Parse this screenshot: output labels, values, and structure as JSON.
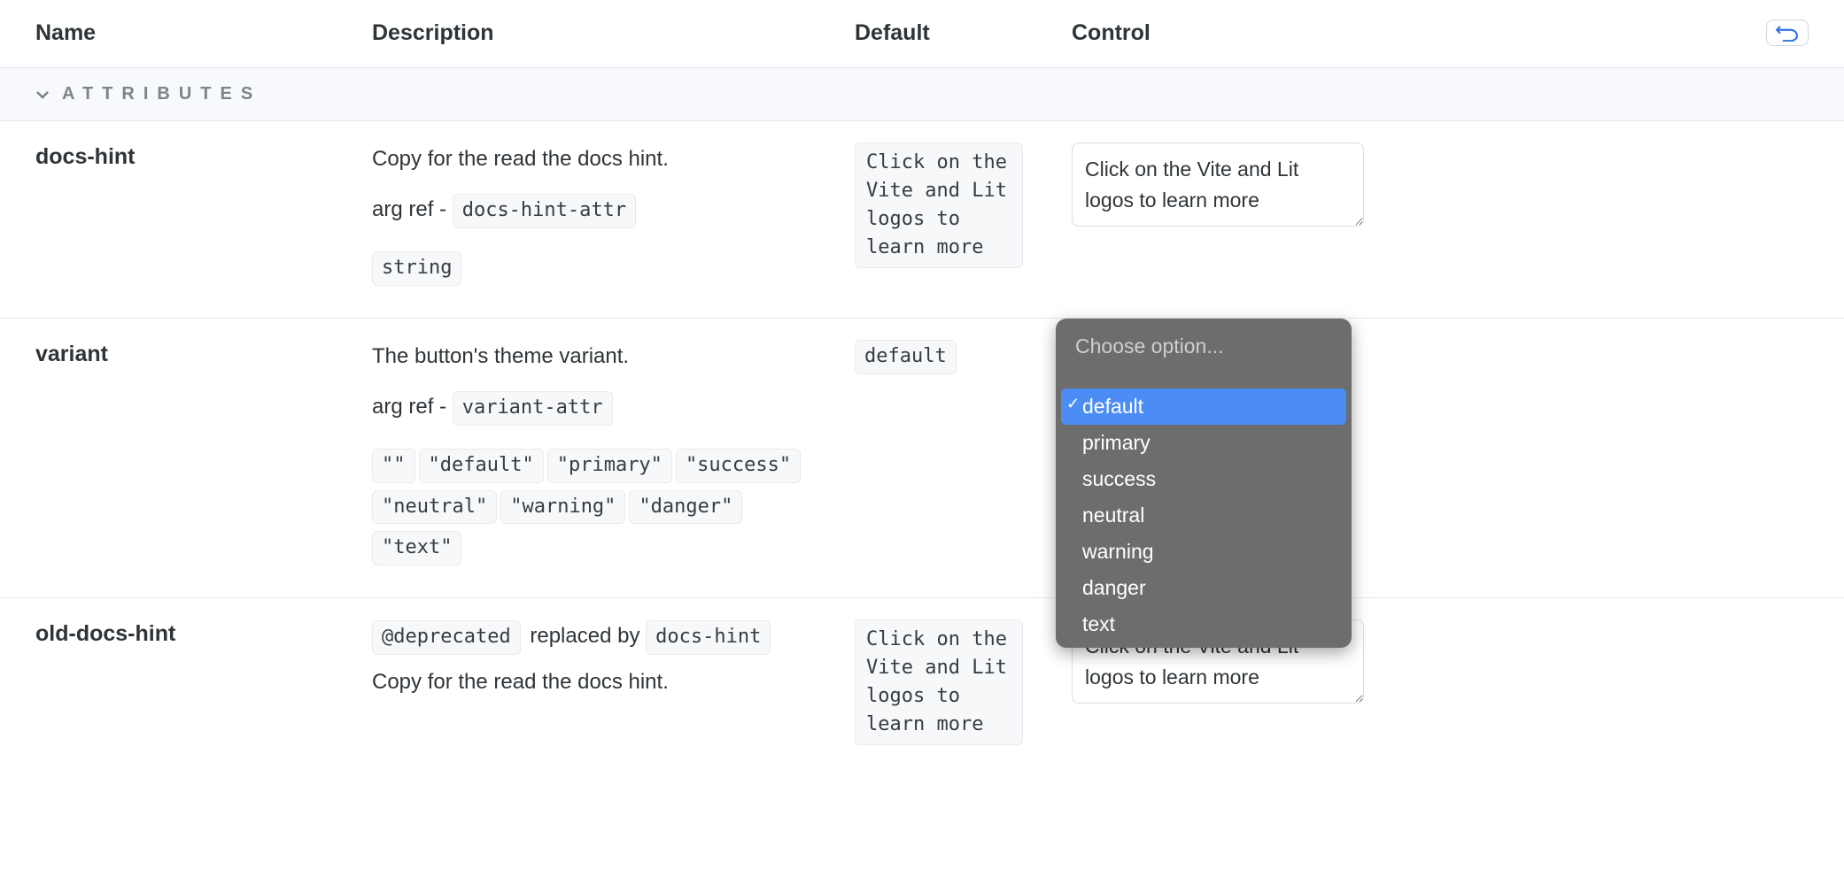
{
  "columns": {
    "name": "Name",
    "description": "Description",
    "default": "Default",
    "control": "Control"
  },
  "section": {
    "title": "ATTRIBUTES"
  },
  "rows": {
    "docsHint": {
      "name": "docs-hint",
      "description": "Copy for the read the docs hint.",
      "argRefPrefix": "arg ref - ",
      "argRef": "docs-hint-attr",
      "type": "string",
      "default": "Click on the Vite and Lit logos to learn more",
      "value": "Click on the Vite and Lit logos to learn more"
    },
    "variant": {
      "name": "variant",
      "description": "The button's theme variant.",
      "argRefPrefix": "arg ref - ",
      "argRef": "variant-attr",
      "options": [
        "\"\"",
        "\"default\"",
        "\"primary\"",
        "\"success\"",
        "\"neutral\"",
        "\"warning\"",
        "\"danger\"",
        "\"text\""
      ],
      "default": "default",
      "dropdown": {
        "placeholder": "Choose option...",
        "items": [
          "default",
          "primary",
          "success",
          "neutral",
          "warning",
          "danger",
          "text"
        ],
        "selected": "default"
      }
    },
    "oldDocsHint": {
      "name": "old-docs-hint",
      "deprecatedTag": "@deprecated",
      "replacedByText": " replaced by ",
      "replacedByRef": "docs-hint",
      "description": "Copy for the read the docs hint.",
      "default": "Click on the Vite and Lit logos to learn more",
      "value": "Click on the Vite and Lit logos to learn more"
    }
  }
}
